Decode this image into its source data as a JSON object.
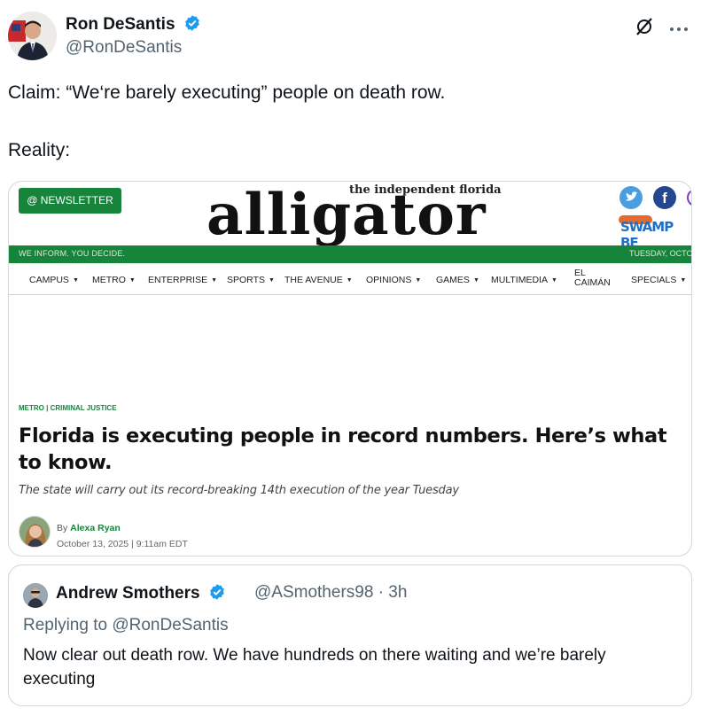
{
  "author": {
    "name": "Ron DeSantis",
    "handle": "@RonDeSantis"
  },
  "tweet": {
    "line1": "Claim: “We‘re barely executing” people on death row.",
    "line2": "Reality:"
  },
  "article": {
    "newsletter_label": "@ NEWSLETTER",
    "masthead_top": "the independent florida",
    "masthead": "alligator",
    "tagline": "WE INFORM. YOU DECIDE.",
    "date_partial": "TUESDAY, OCTO",
    "swamp_label": "SWAMP BE",
    "nav": [
      "CAMPUS",
      "METRO",
      "ENTERPRISE",
      "SPORTS",
      "THE AVENUE",
      "OPINIONS",
      "GAMES",
      "MULTIMEDIA",
      "EL",
      "CAIMÁN",
      "SPECIALS"
    ],
    "category": "METRO | CRIMINAL JUSTICE",
    "headline": "Florida is executing people in record numbers. Here’s what to know.",
    "dek": "The state will carry out its record-breaking 14th execution of the year Tuesday",
    "by": "By ",
    "byline_author": "Alexa Ryan",
    "date": "October 13, 2025 | 9:11am EDT"
  },
  "quote": {
    "name": "Andrew Smothers",
    "handle_time": "@ASmothers98 · 3h",
    "replying_to": "Replying to @RonDeSantis",
    "text": "Now clear out death row. We have hundreds on there waiting and we’re barely executing"
  },
  "colors": {
    "brand_green": "#17843c",
    "verified_blue": "#1d9bf0"
  }
}
